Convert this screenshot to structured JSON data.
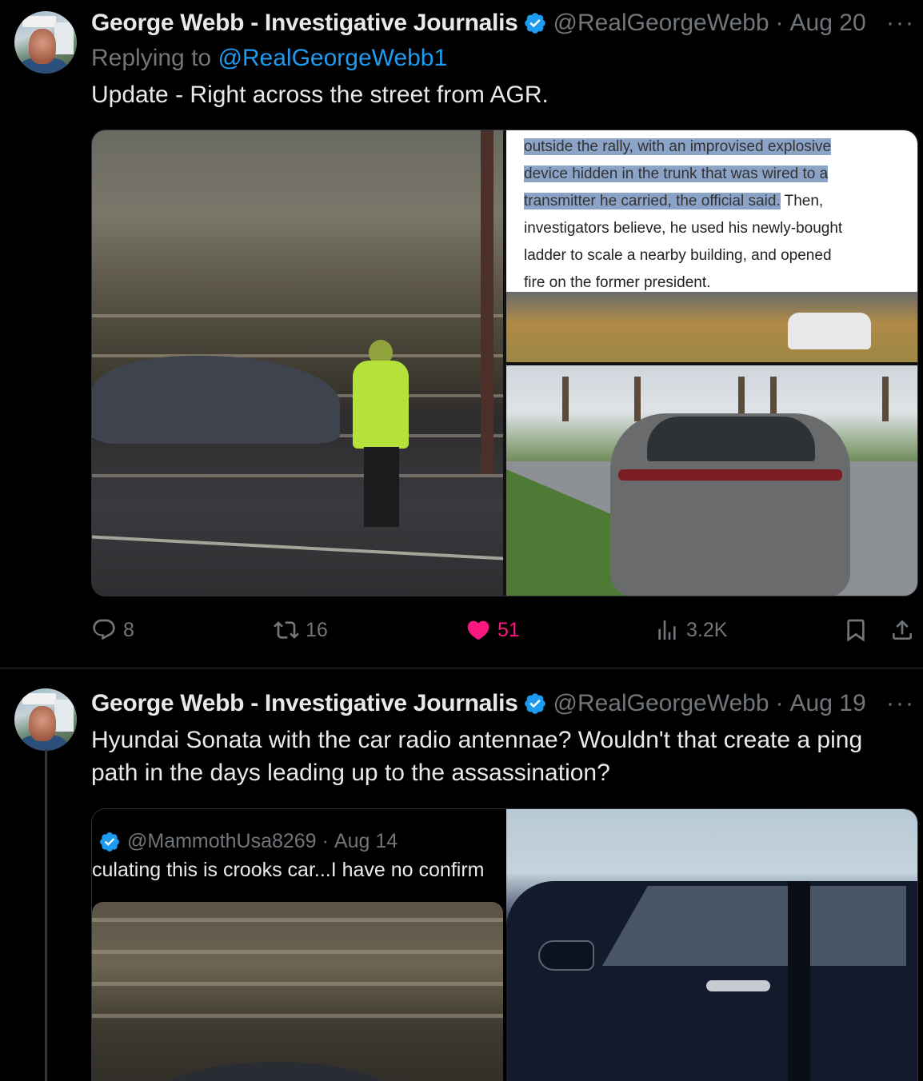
{
  "tweets": [
    {
      "author_name": "George Webb - Investigative Journalis",
      "handle": "@RealGeorgeWebb",
      "separator": "·",
      "date": "Aug 20",
      "more": "···",
      "reply_prefix": "Replying to",
      "reply_to": "@RealGeorgeWebb1",
      "text": "Update - Right across the street from AGR.",
      "media_article": {
        "line0": "outside the rally, with an improvised explosive",
        "line1": "device hidden in the trunk that was wired to a",
        "line2_hl": "transmitter he carried, the official said.",
        "line2_rest": " Then,",
        "line3": "investigators believe, he used his newly-bought",
        "line4": "ladder to scale a nearby building, and opened",
        "line5": "fire on the former president."
      },
      "actions": {
        "replies": "8",
        "reposts": "16",
        "likes": "51",
        "views": "3.2K"
      }
    },
    {
      "author_name": "George Webb - Investigative Journalis",
      "handle": "@RealGeorgeWebb",
      "separator": "·",
      "date": "Aug 19",
      "more": "···",
      "text": "Hyundai Sonata with the car radio antennae?  Wouldn't that create a ping path in the days leading up to the assassination?",
      "quote": {
        "handle": "@MammothUsa8269",
        "separator": "·",
        "date": "Aug 14",
        "text": "culating this is crooks car...I have no confirm"
      }
    }
  ],
  "colors": {
    "background": "#000000",
    "text": "#e7e9ea",
    "muted": "#71767b",
    "link": "#1d9bf0",
    "like": "#f91880",
    "verified": "#1d9bf0"
  }
}
